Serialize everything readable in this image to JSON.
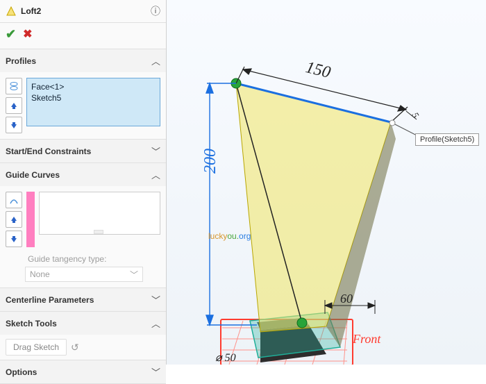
{
  "titlebar": {
    "feature_name": "Loft2"
  },
  "sections": {
    "profiles": {
      "label": "Profiles",
      "items": [
        "Face<1>",
        "Sketch5"
      ]
    },
    "startend": {
      "label": "Start/End Constraints"
    },
    "guides": {
      "label": "Guide Curves",
      "tangency_label": "Guide tangency type:",
      "tangency_value": "None"
    },
    "centerline": {
      "label": "Centerline Parameters"
    },
    "sketchtools": {
      "label": "Sketch Tools",
      "drag_label": "Drag Sketch"
    },
    "options": {
      "label": "Options"
    }
  },
  "viewport": {
    "dim_vertical": "200",
    "dim_top": "150",
    "dim_small": "60",
    "dim_diameter": "⌀ 50",
    "plane_label": "Front",
    "tooltip": "Profile(Sketch5)",
    "watermark": {
      "a": "lucky",
      "b": "ou.",
      "c": "org"
    },
    "leader_len": "5"
  }
}
